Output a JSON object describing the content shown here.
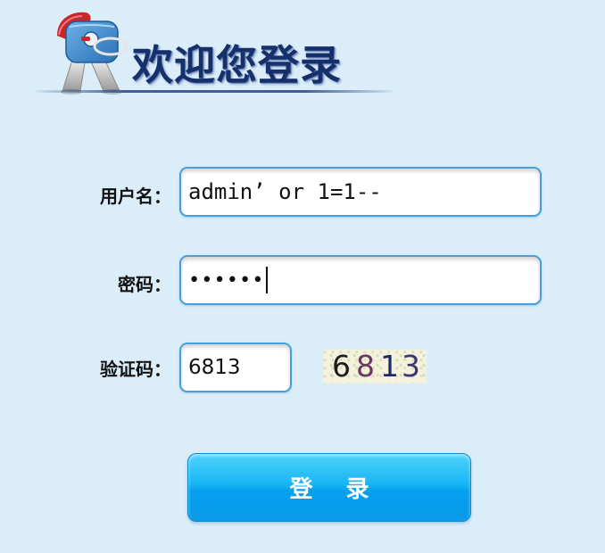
{
  "header": {
    "welcome_text": "欢迎您登录",
    "logo_icon": "person-key-logo-icon"
  },
  "form": {
    "username": {
      "label": "用户名：",
      "value": "admin’ or 1=1--"
    },
    "password": {
      "label": "密码：",
      "masked_value": "••••••"
    },
    "captcha": {
      "label": "验证码：",
      "value": "6813",
      "image_digits": [
        {
          "char": "6",
          "color": "#1c1c1c"
        },
        {
          "char": "8",
          "color": "#6a3a5e"
        },
        {
          "char": "1",
          "color": "#1c2a6b"
        },
        {
          "char": "3",
          "color": "#3d3470"
        }
      ]
    }
  },
  "login_button": {
    "label": "登 录"
  },
  "colors": {
    "background": "#daedf9",
    "field_border": "#4a9fd6",
    "button_top": "#4ed3fb",
    "button_bottom": "#0a9ae9",
    "title": "#16306b"
  }
}
